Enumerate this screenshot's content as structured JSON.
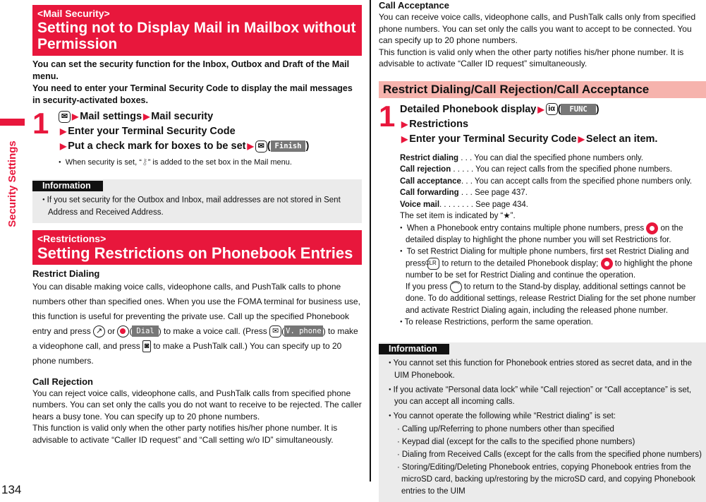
{
  "side_tab": {
    "label": "Security Settings"
  },
  "page_number": "134",
  "mail_security": {
    "category": "<Mail Security>",
    "title": "Setting not to Display Mail in Mailbox without Permission",
    "intro": [
      "You can set the security function for the Inbox, Outbox and Draft of the Mail menu.",
      "You need to enter your Terminal Security Code to display the mail messages in security-activated boxes."
    ],
    "step": {
      "number": "1",
      "key_icon": "mail-key-icon",
      "line1_a": "Mail settings",
      "line1_b": "Mail security",
      "line2": "Enter your Terminal Security Code",
      "line3": "Put a check mark for boxes to be set",
      "softkey": "Finish",
      "note_prefix": "When security is set, “",
      "note_icon": "key-lock-icon",
      "note_suffix": "” is added to the set box in the Mail menu."
    },
    "info": {
      "label": "Information",
      "items": [
        "If you set security for the Outbox and Inbox, mail addresses are not stored in Sent Address and Received Address."
      ]
    }
  },
  "restrictions": {
    "category": "<Restrictions>",
    "title": "Setting Restrictions on Phonebook Entries",
    "restrict_dialing": {
      "heading": "Restrict Dialing",
      "text1": "You can disable making voice calls, videophone calls, and PushTalk calls to phone numbers other than specified ones. When you use the FOMA terminal for business use, this function is useful for preventing the private use. Call up the specified Phonebook entry and press",
      "or": "or",
      "dial_softkey": "Dial",
      "text2": ") to make a voice call. (Press",
      "vphone_softkey": "V. phone",
      "text3": ") to make a videophone call, and press",
      "text4": "to make a PushTalk call.) You can specify up to 20 phone numbers."
    },
    "call_rejection": {
      "heading": "Call Rejection",
      "text": "You can reject voice calls, videophone calls, and PushTalk calls from specified phone numbers. You can set only the calls you do not want to receive to be rejected. The caller hears a busy tone. You can specify up to 20 phone numbers.",
      "text2": "This function is valid only when the other party notifies his/her phone number. It is advisable to activate “Caller ID request” and “Call setting w/o ID” simultaneously."
    },
    "call_acceptance": {
      "heading": "Call Acceptance",
      "text": "You can receive voice calls, videophone calls, and PushTalk calls only from specified phone numbers. You can set only the calls you want to accept to be connected. You can specify up to 20 phone numbers.",
      "text2": "This function is valid only when the other party notifies his/her phone number. It is advisable to activate “Caller ID request” simultaneously."
    }
  },
  "restrict_section": {
    "title": "Restrict Dialing/Call Rejection/Call Acceptance",
    "step": {
      "number": "1",
      "line1": "Detailed Phonebook display",
      "key_label": "iα",
      "softkey": "FUNC",
      "line2": "Restrictions",
      "line3_a": "Enter your Terminal Security Code",
      "line3_b": "Select an item."
    },
    "items": [
      {
        "name": "Restrict dialing",
        "dots": " . . . ",
        "desc": "You can dial the specified phone numbers only."
      },
      {
        "name": "Call rejection",
        "dots": " . . . . . ",
        "desc": "You can reject calls from the specified phone numbers."
      },
      {
        "name": "Call acceptance",
        "dots": ". . . ",
        "desc": "You can accept calls from the specified phone numbers only."
      },
      {
        "name": "Call forwarding",
        "dots": " . . . ",
        "desc": "See page 437."
      },
      {
        "name": "Voice mail",
        "dots": ". . . . . . . . ",
        "desc": "See page 434."
      }
    ],
    "set_item_note": "The set item is indicated by “★”.",
    "notes": {
      "n1_a": "When a Phonebook entry contains multiple phone numbers, press",
      "n1_b": "on the detailed display to highlight the phone number you will set Restrictions for.",
      "n2_a": "To set Restrict Dialing for multiple phone numbers, first set Restrict Dialing and press",
      "clr_key": "CLR",
      "n2_b": "to return to the detailed Phonebook display;",
      "n2_c": "to highlight the phone number to be set for Restrict Dialing and continue the operation.",
      "n2_d": "If you press",
      "n2_e": "to return to the Stand-by display, additional settings cannot be done. To do additional settings, release Restrict Dialing for the set phone number and activate Restrict Dialing again, including the released phone number.",
      "n3": "To release Restrictions, perform the same operation."
    },
    "info": {
      "label": "Information",
      "items": [
        "You cannot set this function for Phonebook entries stored as secret data, and in the UIM Phonebook.",
        "If you activate “Personal data lock” while “Call rejection” or “Call acceptance” is set, you can accept all incoming calls.",
        "You cannot operate the following while “Restrict dialing” is set:"
      ],
      "sub_items": [
        "Calling up/Referring to phone numbers other than specified",
        "Keypad dial (except for the calls to the specified phone numbers)",
        "Dialing from Received Calls (except for the calls from the specified phone numbers)",
        "Storing/Editing/Deleting Phonebook entries, copying Phonebook entries from the microSD card, backing up/restoring by the microSD card, and copying Phonebook entries to the UIM"
      ]
    }
  },
  "colors": {
    "accent_red": "#e8173c",
    "pink_header": "#f6b3ad",
    "info_bg": "#ebebeb"
  }
}
